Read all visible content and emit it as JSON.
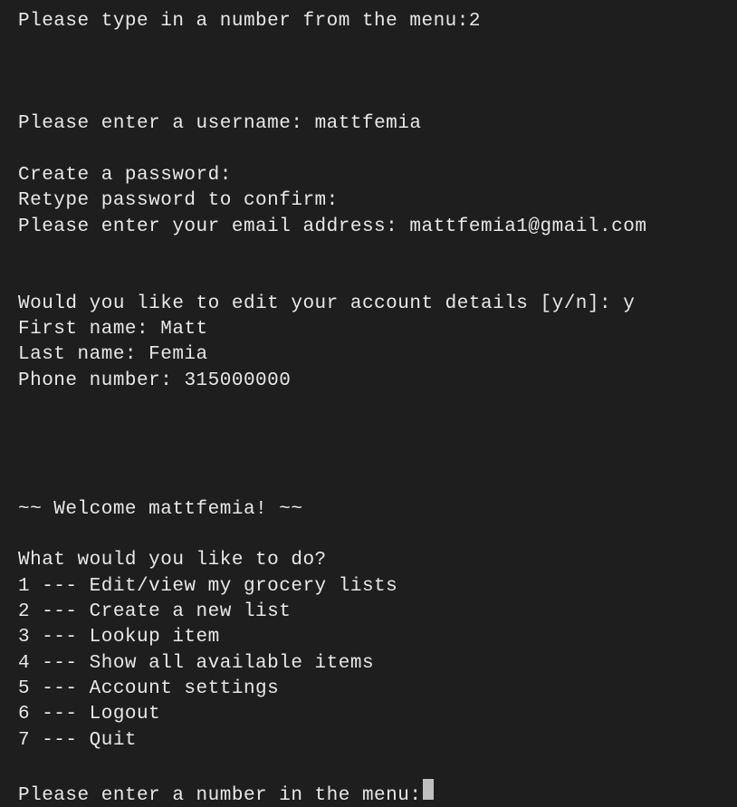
{
  "top_prompt": {
    "label": "Please type in a number from the menu:",
    "value": "2"
  },
  "signup": {
    "username_label": "Please enter a username: ",
    "username_value": "mattfemia",
    "create_password_label": "Create a password:",
    "retype_password_label": "Retype password to confirm:",
    "email_label": "Please enter your email address: ",
    "email_value": "mattfemia1@gmail.com"
  },
  "edit_account": {
    "prompt_label": "Would you like to edit your account details [y/n]: ",
    "prompt_value": "y",
    "first_name_label": "First name: ",
    "first_name_value": "Matt",
    "last_name_label": "Last name: ",
    "last_name_value": "Femia",
    "phone_label": "Phone number: ",
    "phone_value": "315000000"
  },
  "welcome": {
    "banner": "~~ Welcome mattfemia! ~~"
  },
  "menu": {
    "heading": "What would you like to do?",
    "items": [
      "1 --- Edit/view my grocery lists",
      "2 --- Create a new list",
      "3 --- Lookup item",
      "4 --- Show all available items",
      "5 --- Account settings",
      "6 --- Logout",
      "7 --- Quit"
    ],
    "prompt_label": "Please enter a number in the menu: "
  }
}
